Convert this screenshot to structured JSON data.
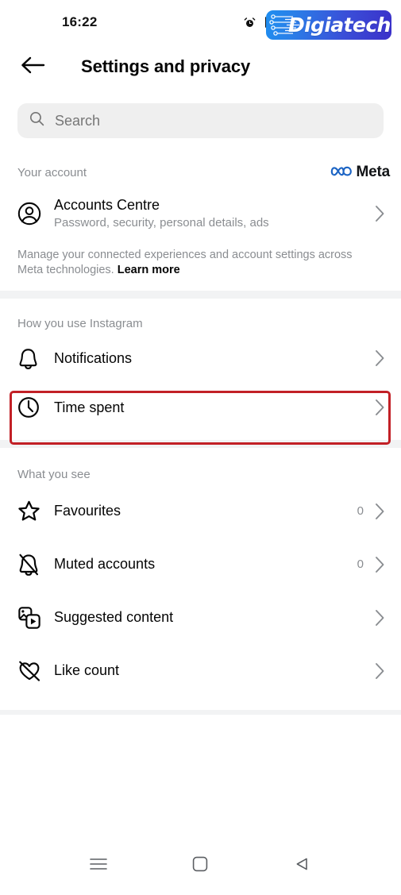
{
  "status_bar": {
    "time": "16:22",
    "icons": [
      "alarm-icon",
      "bluetooth-icon"
    ]
  },
  "watermark": {
    "text": "Digiatech",
    "gradient_from": "#1e8ef0",
    "gradient_to": "#3b30c9",
    "text_color": "#ffffff"
  },
  "app_bar": {
    "back_icon": "arrow-left-icon",
    "title": "Settings and privacy"
  },
  "search": {
    "placeholder": "Search",
    "value": "",
    "icon": "search-icon",
    "background": "#efefef"
  },
  "your_account": {
    "section_label": "Your account",
    "brand": {
      "logo": "meta-infinity-icon",
      "name": "Meta",
      "logo_color": "#1c64c4"
    },
    "row": {
      "icon": "account-circle-icon",
      "title": "Accounts Centre",
      "subtitle": "Password, security, personal details, ads",
      "chevron": "chevron-right-icon"
    },
    "blurb_text": "Manage your connected experiences and account settings across Meta technologies. ",
    "blurb_link": "Learn more"
  },
  "how_you_use": {
    "section_label": "How you use Instagram",
    "items": [
      {
        "icon": "bell-icon",
        "label": "Notifications",
        "count": "",
        "chevron": "chevron-right-icon",
        "highlighted": true
      },
      {
        "icon": "clock-icon",
        "label": "Time spent",
        "count": "",
        "chevron": "chevron-right-icon",
        "highlighted": false
      }
    ]
  },
  "what_you_see": {
    "section_label": "What you see",
    "items": [
      {
        "icon": "star-icon",
        "label": "Favourites",
        "count": "0",
        "chevron": "chevron-right-icon"
      },
      {
        "icon": "bell-slash-icon",
        "label": "Muted accounts",
        "count": "0",
        "chevron": "chevron-right-icon"
      },
      {
        "icon": "suggested-content-icon",
        "label": "Suggested content",
        "count": "",
        "chevron": "chevron-right-icon"
      },
      {
        "icon": "heart-slash-icon",
        "label": "Like count",
        "count": "",
        "chevron": "chevron-right-icon"
      }
    ]
  },
  "highlight": {
    "target": "Notifications",
    "color": "#c22026"
  },
  "nav_bar": {
    "buttons": [
      {
        "icon": "recents-menu-icon",
        "name": "recents"
      },
      {
        "icon": "home-square-icon",
        "name": "home"
      },
      {
        "icon": "back-triangle-icon",
        "name": "back"
      }
    ]
  }
}
